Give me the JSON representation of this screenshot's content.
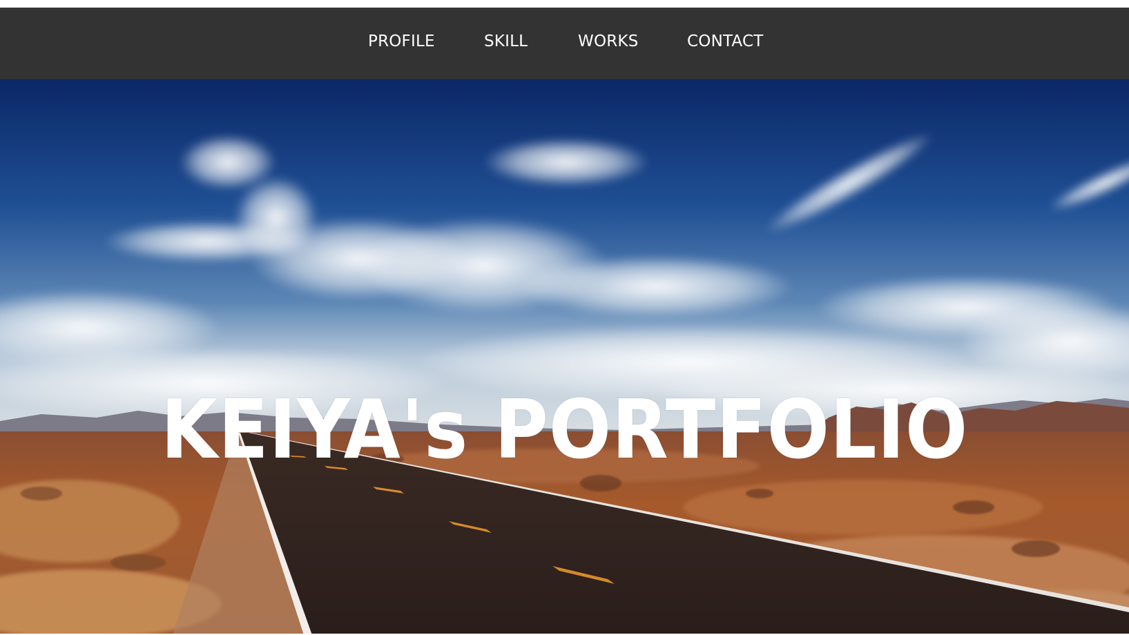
{
  "nav": {
    "items": [
      {
        "label": "PROFILE"
      },
      {
        "label": "SKILL"
      },
      {
        "label": "WORKS"
      },
      {
        "label": "CONTACT"
      }
    ]
  },
  "hero": {
    "title": "KEIYA's PORTFOLIO",
    "image": "desert-highway-photo"
  },
  "colors": {
    "navbar_bg": "#333333",
    "nav_text": "#ffffff",
    "title_text": "#ffffff",
    "sky_top": "#0b2a6b",
    "desert": "#a9562a"
  }
}
